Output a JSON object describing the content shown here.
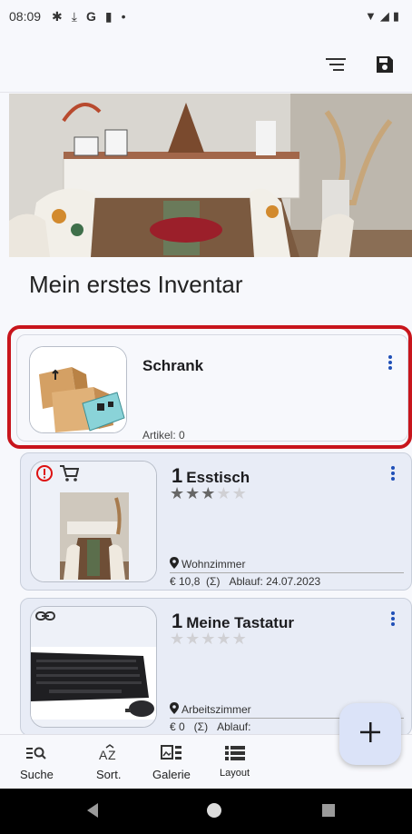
{
  "status_bar": {
    "time": "08:09",
    "dot": "•"
  },
  "toolbar": {
    "icons": [
      "filter-list-icon",
      "save-icon"
    ]
  },
  "inventory": {
    "title": "Mein erstes Inventar"
  },
  "items": [
    {
      "name": "Schrank",
      "count_label": "Artikel: 0"
    },
    {
      "quantity": "1",
      "name": "Esstisch",
      "rating": 3,
      "max_rating": 5,
      "location": "Wohnzimmer",
      "price_line": "€ 10,8  (Σ)   Ablauf: 24.07.2023",
      "badges": [
        "alert-icon",
        "cart-icon"
      ]
    },
    {
      "quantity": "1",
      "name": "Meine Tastatur",
      "rating": 0,
      "max_rating": 5,
      "location": "Arbeitszimmer",
      "price_line": "€ 0   (Σ)   Ablauf:",
      "badges": [
        "link-icon"
      ]
    }
  ],
  "bottom_nav": {
    "search": "Suche",
    "sort": "Sort.",
    "gallery": "Galerie",
    "layout": "Layout"
  },
  "colors": {
    "accent": "#1f4fb7",
    "highlight": "#c8151c",
    "card_bg": "#e8ecf6",
    "fab_bg": "#dbe3f8"
  }
}
